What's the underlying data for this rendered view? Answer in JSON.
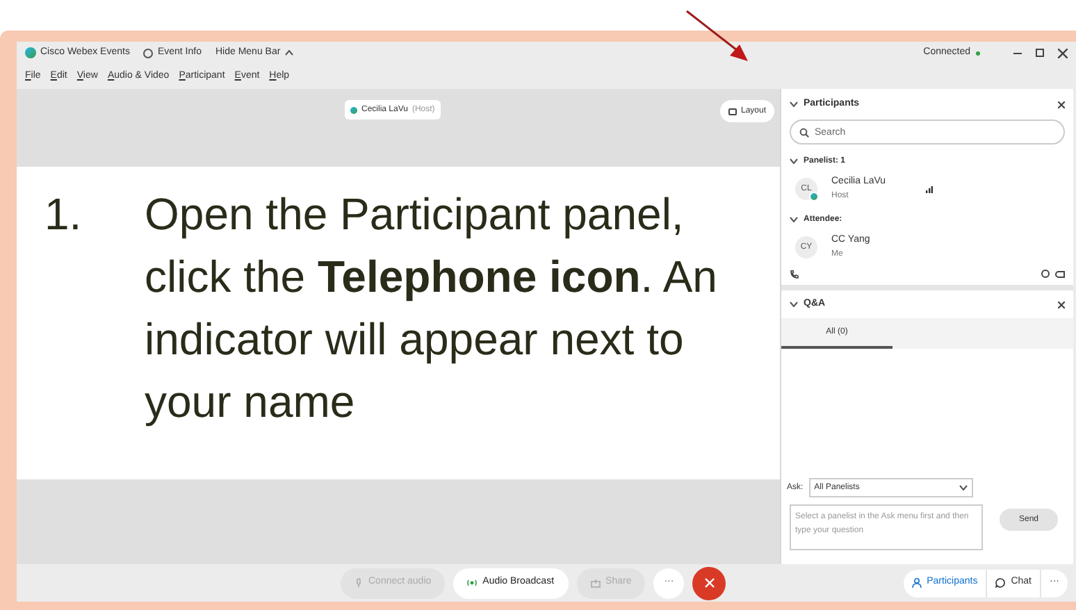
{
  "title_bar": {
    "app_title": "Cisco Webex Events",
    "event_info": "Event Info",
    "hide_menu": "Hide Menu Bar",
    "status": "Connected",
    "connected": true
  },
  "menu": [
    "File",
    "Edit",
    "View",
    "Audio & Video",
    "Participant",
    "Event",
    "Help"
  ],
  "stage": {
    "speaker_name": "Cecilia LaVu",
    "speaker_role": "(Host)",
    "layout_button": "Layout"
  },
  "slide": {
    "number": "1.",
    "text": "Open the Participant panel, click the **Telephone icon**.  An indicator will appear next to your name"
  },
  "participants": {
    "title": "Participants",
    "search": {
      "placeholder": "Search"
    },
    "groups": [
      {
        "label": "Panelist: 1",
        "expanded": true,
        "members": [
          {
            "initials": "CL",
            "name": "Cecilia LaVu",
            "role": "Host",
            "audio": true,
            "webex_badge": true
          }
        ]
      },
      {
        "label": "Attendee:",
        "expanded": true,
        "members": [
          {
            "initials": "CY",
            "name": "CC Yang",
            "role": "Me",
            "audio": false,
            "webex_badge": false
          }
        ]
      }
    ]
  },
  "qa": {
    "title": "Q&A",
    "tabs": [
      {
        "label": "All (0)",
        "selected": true
      }
    ],
    "ask_label": "Ask:",
    "ask_select": "All Panelists",
    "question": {
      "placeholder": "Select a panelist in the Ask menu first and then type your question"
    },
    "send": "Send"
  },
  "controls": [
    {
      "kind": "audio",
      "label": "Connect audio",
      "disabled": true
    },
    {
      "kind": "broadcast",
      "label": "Audio Broadcast",
      "disabled": false
    },
    {
      "kind": "share",
      "label": "Share",
      "disabled": true
    },
    {
      "kind": "more",
      "label": "···"
    },
    {
      "kind": "end"
    }
  ],
  "panel_buttons": [
    {
      "kind": "participants",
      "label": "Participants",
      "selected": true
    },
    {
      "kind": "chat",
      "label": "Chat",
      "selected": false
    },
    {
      "kind": "more",
      "label": "···",
      "selected": false
    }
  ]
}
